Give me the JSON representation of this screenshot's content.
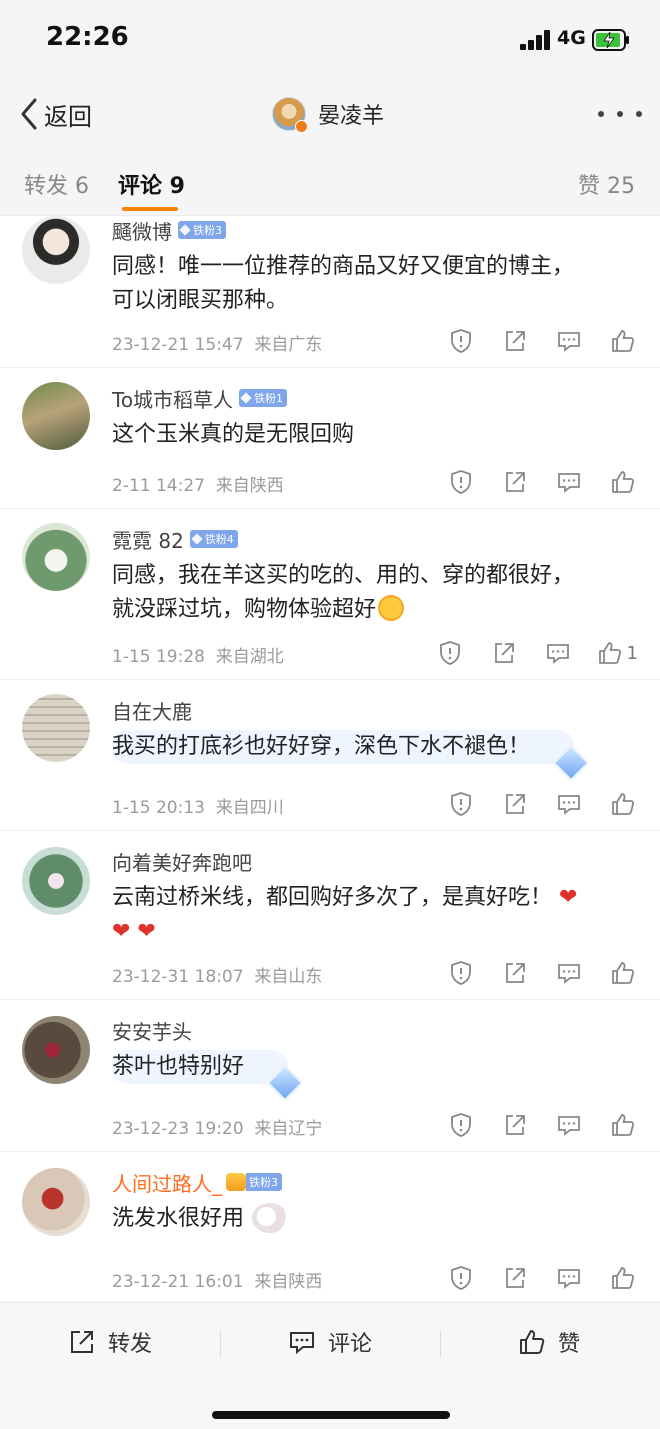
{
  "status_bar": {
    "time": "22:26",
    "network": "4G"
  },
  "nav": {
    "back_label": "返回",
    "title": "晏凌羊"
  },
  "tabs": [
    {
      "label": "转发 6"
    },
    {
      "label": "评论 9"
    },
    {
      "label": "赞 25"
    }
  ],
  "comments": [
    {
      "user": "颾微博",
      "badge": "铁粉3",
      "text1": "同感！唯一一位推荐的商品又好又便宜的博主，",
      "text2": "可以闭眼买那种。",
      "time": "23-12-21 15:47",
      "location": "来自广东"
    },
    {
      "user": "To城市稻草人",
      "badge": "铁粉1",
      "text1": "这个玉米真的是无限回购",
      "time": "2-11 14:27",
      "location": "来自陕西"
    },
    {
      "user": "霓霓 82",
      "badge": "铁粉4",
      "text1": "同感，我在羊这买的吃的、用的、穿的都很好，",
      "text2": "就没踩过坑，购物体验超好",
      "time": "1-15 19:28",
      "location": "来自湖北",
      "likes": "1"
    },
    {
      "user": "自在大鹿",
      "text1": "我买的打底衫也好好穿，深色下水不褪色！",
      "time": "1-15 20:13",
      "location": "来自四川"
    },
    {
      "user": "向着美好奔跑吧",
      "text1": "云南过桥米线，都回购好多次了，是真好吃！",
      "hearts1": "❤",
      "hearts2": "❤ ❤",
      "time": "23-12-31 18:07",
      "location": "来自山东"
    },
    {
      "user": "安安芋头",
      "text1": "茶叶也特别好",
      "time": "23-12-23 19:20",
      "location": "来自辽宁"
    },
    {
      "user": "人间过路人_",
      "badge": "铁粉3",
      "text1": "洗发水很好用",
      "time": "23-12-21 16:01",
      "location": "来自陕西"
    }
  ],
  "bottom_bar": {
    "repost_label": "转发",
    "comment_label": "评论",
    "like_label": "赞"
  },
  "colors": {
    "accent": "#ff8200",
    "username_orange": "#ff6d1f",
    "fan_badge": "#7fa6ea"
  }
}
